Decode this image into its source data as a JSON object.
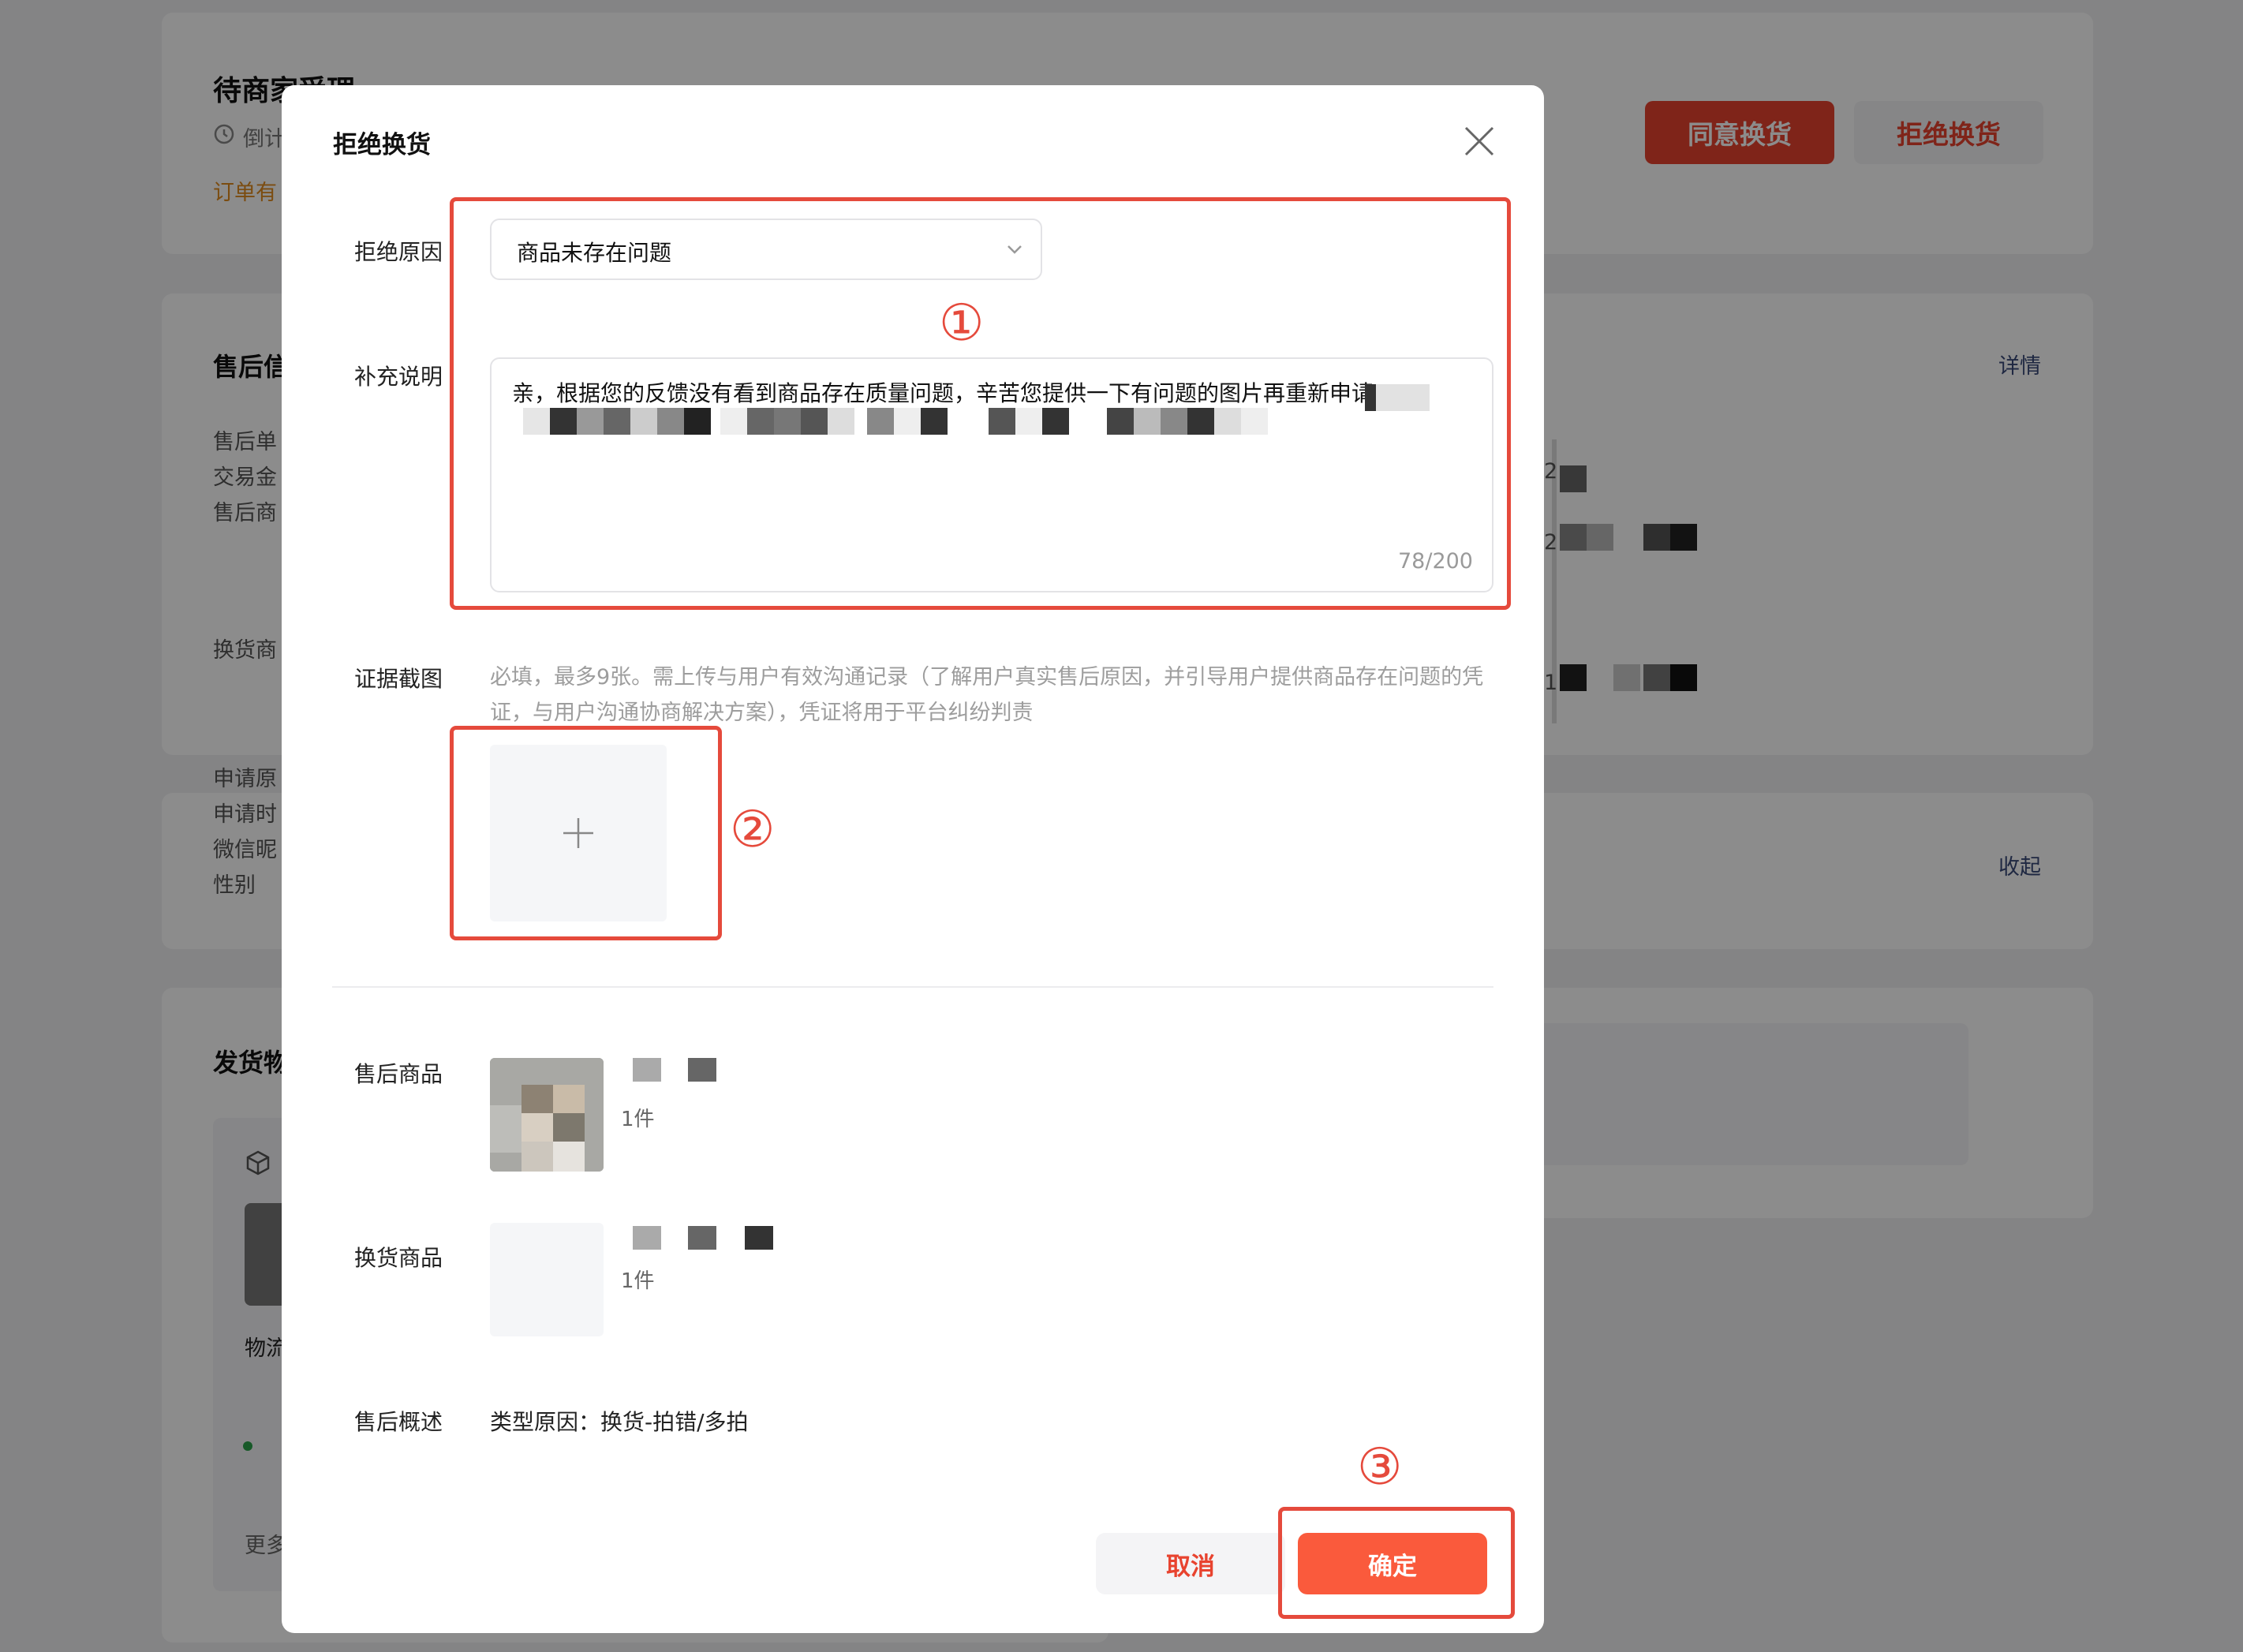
{
  "background": {
    "status_title": "待商家受理",
    "countdown_label": "倒计",
    "order_note": "订单有",
    "agree_button": "同意换货",
    "reject_button": "拒绝换货",
    "aftersale_section": "售后信",
    "detail_link": "详情",
    "rows_a": [
      "售后单",
      "交易金",
      "售后商"
    ],
    "exchange_goods": "换货商",
    "rows_b": [
      "申请原",
      "申请时",
      "微信昵",
      "性别"
    ],
    "collapse_link": "收起",
    "shipping_section": "发货物",
    "logistics_label": "物流",
    "more_label": "更多",
    "side_numbers": [
      "2",
      "2",
      "1"
    ]
  },
  "dialog": {
    "title": "拒绝换货",
    "close_icon": "close-icon",
    "reason_label": "拒绝原因",
    "reason_value": "商品未存在问题",
    "note_label": "补充说明",
    "note_text": "亲，根据您的反馈没有看到商品存在质量问题，辛苦您提供一下有问题的图片再重新申请,",
    "note_count": "78/200",
    "evidence_label": "证据截图",
    "evidence_hint": "必填，最多9张。需上传与用户有效沟通记录（了解用户真实售后原因，并引导用户提供商品存在问题的凭证，与用户沟通协商解决方案），凭证将用于平台纠纷判责",
    "aftersale_goods_label": "售后商品",
    "aftersale_goods_qty": "1件",
    "exchange_goods_label": "换货商品",
    "exchange_goods_qty": "1件",
    "summary_label": "售后概述",
    "summary_value": "类型原因：换货-拍错/多拍",
    "cancel_button": "取消",
    "confirm_button": "确定"
  },
  "annotations": [
    "①",
    "②",
    "③"
  ],
  "colors": {
    "primary_red": "#e8432f",
    "confirm_orange": "#fa5a3c",
    "annotation_red": "#e54a3c"
  }
}
